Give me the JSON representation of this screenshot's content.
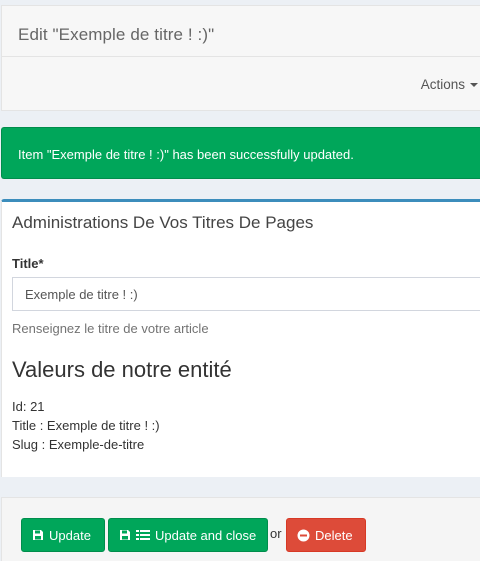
{
  "header": {
    "title": "Edit \"Exemple de titre ! :)\"",
    "actions_label": "Actions"
  },
  "alert": {
    "message": "Item \"Exemple de titre ! :)\" has been successfully updated."
  },
  "form": {
    "box_title": "Administrations De Vos Titres De Pages",
    "title_label": "Title*",
    "title_value": "Exemple de titre ! :)",
    "help_text": "Renseignez le titre de votre article",
    "entity_heading": "Valeurs de notre entité",
    "entity_lines": [
      "Id: 21",
      "Title : Exemple de titre ! :)",
      "Slug : Exemple-de-titre"
    ]
  },
  "footer": {
    "update_label": "Update",
    "update_close_label": "Update and close",
    "or_text": "or",
    "delete_label": "Delete"
  },
  "colors": {
    "success": "#00a65a",
    "danger": "#dd4b39",
    "primary": "#3c8dbc"
  },
  "icons": {
    "update": "save-icon",
    "update_close": [
      "save-icon",
      "list-icon"
    ],
    "delete": "minus-circle-icon",
    "actions": "caret-down-icon"
  }
}
